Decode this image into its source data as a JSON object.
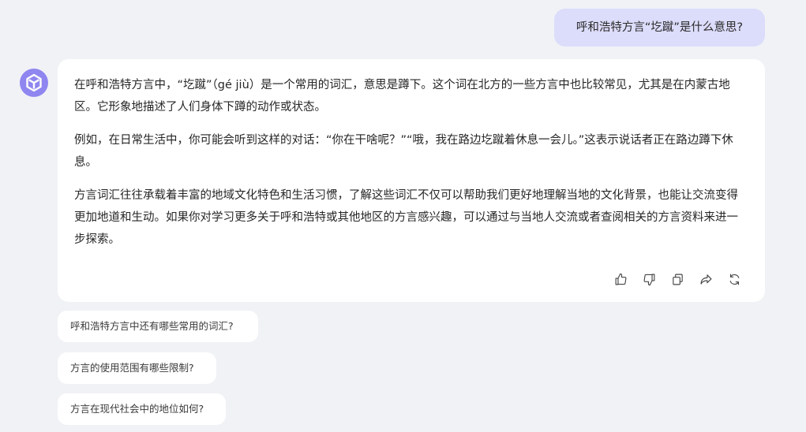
{
  "user_message": {
    "text": "呼和浩特方言“圪蹴”是什么意思?"
  },
  "assistant": {
    "avatar_icon": "assistant-logo-icon",
    "accent_color": "#8f86f0",
    "paragraphs": [
      "在呼和浩特方言中，“圪蹴”（gé jiù）是一个常用的词汇，意思是蹲下。这个词在北方的一些方言中也比较常见，尤其是在内蒙古地区。它形象地描述了人们身体下蹲的动作或状态。",
      "例如，在日常生活中，你可能会听到这样的对话：“你在干啥呢？”“哦，我在路边圪蹴着休息一会儿。”这表示说话者正在路边蹲下休息。",
      "方言词汇往往承载着丰富的地域文化特色和生活习惯，了解这些词汇不仅可以帮助我们更好地理解当地的文化背景，也能让交流变得更加地道和生动。如果你对学习更多关于呼和浩特或其他地区的方言感兴趣，可以通过与当地人交流或者查阅相关的方言资料来进一步探索。"
    ],
    "toolbar": {
      "icons": [
        "thumbs-up-icon",
        "thumbs-down-icon",
        "copy-icon",
        "share-icon",
        "regenerate-icon"
      ]
    }
  },
  "suggestions": [
    "呼和浩特方言中还有哪些常用的词汇?",
    "方言的使用范围有哪些限制?",
    "方言在现代社会中的地位如何?"
  ],
  "colors": {
    "page_background": "#f1f2f6",
    "user_bubble": "#dcdcfb",
    "card_background": "#ffffff"
  }
}
